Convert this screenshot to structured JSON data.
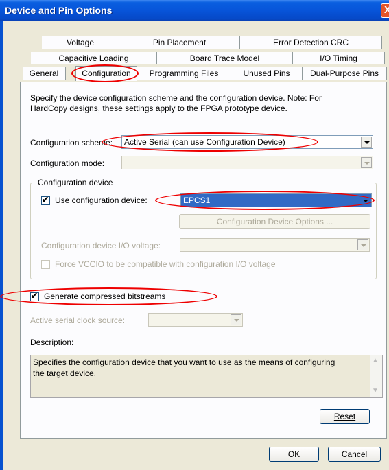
{
  "window": {
    "title": "Device and Pin Options",
    "close_glyph": "X"
  },
  "tabs": {
    "row1": [
      "Voltage",
      "Pin Placement",
      "Error Detection CRC"
    ],
    "row2": [
      "Capacitive Loading",
      "Board Trace Model",
      "I/O Timing"
    ],
    "row3": [
      "General",
      "Configuration",
      "Programming Files",
      "Unused Pins",
      "Dual-Purpose Pins"
    ]
  },
  "intro": {
    "line1": "Specify the device configuration scheme and the configuration device. Note: For",
    "line2": "HardCopy designs, these settings apply to the FPGA prototype device."
  },
  "config_scheme": {
    "label": "Configuration scheme:",
    "value": "Active Serial (can use Configuration Device)"
  },
  "config_mode": {
    "label": "Configuration mode:",
    "value": ""
  },
  "config_device_group": {
    "title": "Configuration device",
    "use_device_label": "Use configuration device:",
    "use_device_checked": true,
    "device_value": "EPCS1",
    "options_button": "Configuration Device Options ...",
    "io_voltage_label": "Configuration device I/O voltage:",
    "force_vccio_label": "Force VCCIO to be compatible with configuration I/O voltage",
    "force_vccio_checked": false
  },
  "generate_compressed": {
    "label": "Generate compressed bitstreams",
    "checked": true
  },
  "serial_clock": {
    "label": "Active serial clock source:",
    "value": ""
  },
  "description": {
    "label": "Description:",
    "line1": "Specifies the configuration device that you want to use as the means of configuring",
    "line2": "the target device."
  },
  "buttons": {
    "reset": "Reset",
    "ok": "OK",
    "cancel": "Cancel"
  },
  "colors": {
    "titlebar": "#0754d9",
    "dialog_bg": "#ece9d8",
    "highlight": "#316ac5",
    "annotation": "#e00000"
  }
}
